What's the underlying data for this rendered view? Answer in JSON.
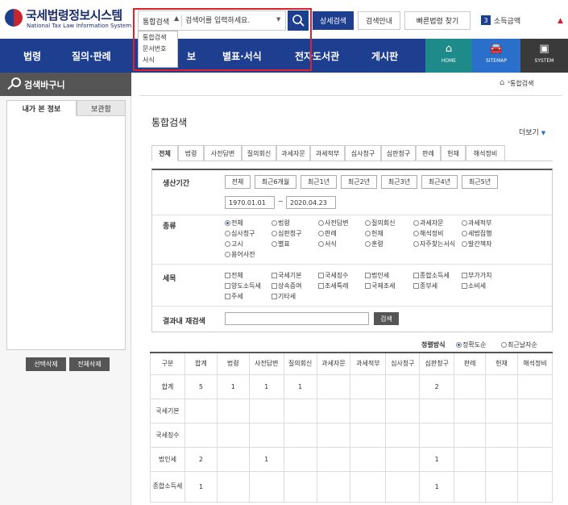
{
  "header": {
    "logo_title": "국세법령정보시스템",
    "logo_subtitle": "National Tax Law Information System",
    "search_scope": "통합검색",
    "search_placeholder": "검색어를 입력하세요.",
    "scope_options": [
      "통합검색",
      "문서번호",
      "서식"
    ],
    "detail_search": "상세검색",
    "search_guide": "검색안내",
    "quick_law": "빠른법령 찾기",
    "count_badge": "3",
    "count_label": "소득금액"
  },
  "nav": {
    "items": [
      "법령",
      "질의·판례",
      "",
      "별표·서식",
      "전자도서관",
      "게시판"
    ],
    "partial_item": "보",
    "home": "HOME",
    "sitemap": "SITEMAP",
    "system": "SYSTEM"
  },
  "left": {
    "title": "검색바구니",
    "tab_mine": "내가 본 정보",
    "tab_storage": "보관함",
    "delete_selected": "선택삭제",
    "delete_all": "전체삭제"
  },
  "breadcrumb": "통합검색",
  "page_title": "통합검색",
  "more": "더보기",
  "result_tabs": [
    "전체",
    "법령",
    "사전답변",
    "질의회신",
    "과세자문",
    "과세적부",
    "심사청구",
    "심판청구",
    "판례",
    "헌재",
    "해석정비"
  ],
  "filter": {
    "period_label": "생산기간",
    "period_buttons": [
      "전체",
      "최근6개월",
      "최근1년",
      "최근2년",
      "최근3년",
      "최근4년",
      "최근5년"
    ],
    "date_from": "1970.01.01",
    "date_sep": "~",
    "date_to": "2020.04.23",
    "type_label": "종류",
    "types": [
      "전체",
      "법령",
      "사전답변",
      "질의회신",
      "과세자문",
      "과세적부",
      "심사청구",
      "심판청구",
      "판례",
      "헌재",
      "해석정비",
      "세법집행",
      "고시",
      "별표",
      "서식",
      "훈령",
      "자주찾는서식",
      "발간책자",
      "용어사전"
    ],
    "tax_label": "세목",
    "taxes": [
      "전체",
      "국세기본",
      "국세징수",
      "법인세",
      "종합소득세",
      "부가가치",
      "양도소득세",
      "상속증여",
      "조세특례",
      "국제조세",
      "종부세",
      "소비세",
      "주세",
      "기타세"
    ],
    "research_label": "결과내 재검색",
    "research_btn": "검색"
  },
  "sort": {
    "label": "정렬방식",
    "options": [
      "정확도순",
      "최근날자순"
    ]
  },
  "table": {
    "headers": [
      "구분",
      "합계",
      "법령",
      "사전답변",
      "질의회신",
      "과세자문",
      "과세적부",
      "심사청구",
      "심판청구",
      "판례",
      "헌재",
      "해석정비"
    ],
    "rows": [
      [
        "합계",
        "5",
        "1",
        "1",
        "1",
        "",
        "",
        "",
        "2",
        "",
        "",
        ""
      ],
      [
        "국세기본",
        "",
        "",
        "",
        "",
        "",
        "",
        "",
        "",
        "",
        "",
        ""
      ],
      [
        "국세징수",
        "",
        "",
        "",
        "",
        "",
        "",
        "",
        "",
        "",
        "",
        ""
      ],
      [
        "법인세",
        "2",
        "",
        "1",
        "",
        "",
        "",
        "",
        "1",
        "",
        "",
        ""
      ],
      [
        "종합소득세",
        "1",
        "",
        "",
        "",
        "",
        "",
        "",
        "1",
        "",
        "",
        ""
      ]
    ]
  }
}
